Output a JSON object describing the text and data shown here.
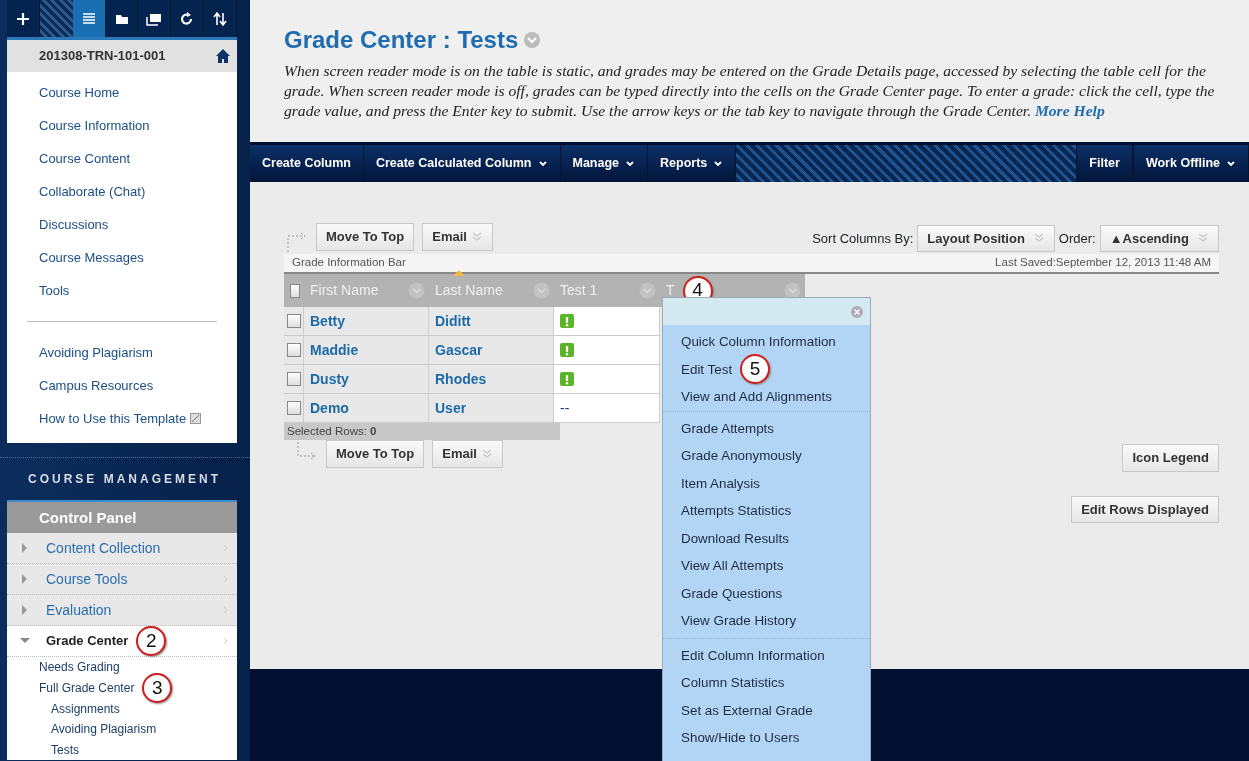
{
  "sidebar": {
    "course_id": "201308-TRN-101-001",
    "menu_groups": [
      [
        {
          "label": "Course Home"
        },
        {
          "label": "Course Information"
        },
        {
          "label": "Course Content"
        },
        {
          "label": "Collaborate (Chat)"
        },
        {
          "label": "Discussions"
        },
        {
          "label": "Course Messages"
        },
        {
          "label": "Tools"
        }
      ],
      [
        {
          "label": "Avoiding Plagiarism"
        },
        {
          "label": "Campus Resources"
        },
        {
          "label": "How to Use this Template",
          "external": true
        }
      ]
    ],
    "management_title": "COURSE MANAGEMENT",
    "control_panel": "Control Panel",
    "sections": [
      {
        "label": "Content Collection",
        "expanded": false
      },
      {
        "label": "Course Tools",
        "expanded": false
      },
      {
        "label": "Evaluation",
        "expanded": false
      },
      {
        "label": "Grade Center",
        "expanded": true,
        "callout": "2",
        "children": [
          {
            "label": "Needs Grading"
          },
          {
            "label": "Full Grade Center",
            "callout": "3",
            "children": [
              {
                "label": "Assignments"
              },
              {
                "label": "Avoiding Plagiarism"
              },
              {
                "label": "Tests"
              }
            ]
          }
        ]
      }
    ]
  },
  "page": {
    "title": "Grade Center : Tests",
    "description": "When screen reader mode is on the table is static, and grades may be entered on the Grade Details page, accessed by selecting the table cell for the grade. When screen reader mode is off, grades can be typed directly into the cells on the Grade Center page. To enter a grade: click the cell, type the grade value, and press the Enter key to submit. Use the arrow keys or the tab key to navigate through the Grade Center.",
    "help_link": "More Help"
  },
  "action_bar": {
    "left": [
      {
        "label": "Create Column",
        "dropdown": false
      },
      {
        "label": "Create Calculated Column",
        "dropdown": true
      },
      {
        "label": "Manage",
        "dropdown": true
      },
      {
        "label": "Reports",
        "dropdown": true
      }
    ],
    "right": [
      {
        "label": "Filter",
        "dropdown": false
      },
      {
        "label": "Work Offline",
        "dropdown": true
      }
    ]
  },
  "toolbar": {
    "top_buttons": [
      {
        "label": "Move To Top",
        "dropdown": false
      },
      {
        "label": "Email",
        "dropdown": true
      }
    ],
    "sort_label": "Sort Columns By:",
    "sort_value": "Layout Position",
    "order_label": "Order:",
    "order_value": "▲Ascending",
    "info_bar": "Grade Information Bar",
    "last_saved": "Last Saved:September 12, 2013 11:48 AM",
    "bottom_buttons": [
      {
        "label": "Move To Top",
        "dropdown": false
      },
      {
        "label": "Email",
        "dropdown": true
      }
    ]
  },
  "table": {
    "columns": [
      {
        "label": "First Name",
        "sorted": false
      },
      {
        "label": "Last Name",
        "sorted": true
      },
      {
        "label": "Test 1",
        "sorted": false
      },
      {
        "label": "T",
        "sorted": false,
        "callout": "4"
      }
    ],
    "rows": [
      {
        "first": "Betty",
        "last": "Diditt",
        "grade": {
          "kind": "needs_grading"
        },
        "checked": false
      },
      {
        "first": "Maddie",
        "last": "Gascar",
        "grade": {
          "kind": "needs_grading"
        },
        "checked": false
      },
      {
        "first": "Dusty",
        "last": "Rhodes",
        "grade": {
          "kind": "needs_grading"
        },
        "checked": false
      },
      {
        "first": "Demo",
        "last": "User",
        "grade": {
          "kind": "text",
          "text": "--"
        },
        "checked": false
      }
    ],
    "select_all": {
      "checked": false
    },
    "selected_rows": "Selected Rows: **0**"
  },
  "side_buttons": [
    "Icon Legend",
    "Edit Rows Displayed"
  ],
  "context_menu": {
    "groups": [
      [
        {
          "label": "Quick Column Information"
        },
        {
          "label": "Edit Test",
          "callout": "5"
        },
        {
          "label": "View and Add Alignments"
        }
      ],
      [
        {
          "label": "Grade Attempts"
        },
        {
          "label": "Grade Anonymously"
        },
        {
          "label": "Item Analysis"
        },
        {
          "label": "Attempts Statistics"
        },
        {
          "label": "Download Results"
        },
        {
          "label": "View All Attempts"
        },
        {
          "label": "Grade Questions"
        },
        {
          "label": "View Grade History"
        }
      ],
      [
        {
          "label": "Edit Column Information"
        },
        {
          "label": "Column Statistics"
        },
        {
          "label": "Set as External Grade"
        },
        {
          "label": "Show/Hide to Users"
        }
      ]
    ]
  }
}
